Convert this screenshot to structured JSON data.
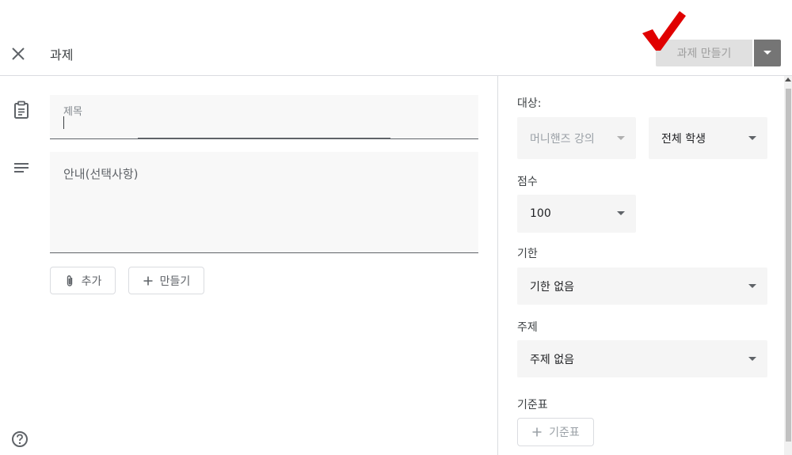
{
  "header": {
    "title": "과제",
    "create_label": "과제 만들기",
    "close_icon": "close-icon",
    "accent_check_color": "#e00000"
  },
  "left": {
    "title_placeholder": "제목",
    "description_placeholder": "안내(선택사항)",
    "add_label": "추가",
    "create_label": "만들기"
  },
  "right": {
    "for_label": "대상:",
    "class_value": "머니핸즈 강의",
    "students_value": "전체 학생",
    "points_label": "점수",
    "points_value": "100",
    "due_label": "기한",
    "due_value": "기한 없음",
    "topic_label": "주제",
    "topic_value": "주제 없음",
    "rubric_label": "기준표",
    "rubric_button": "기준표"
  }
}
